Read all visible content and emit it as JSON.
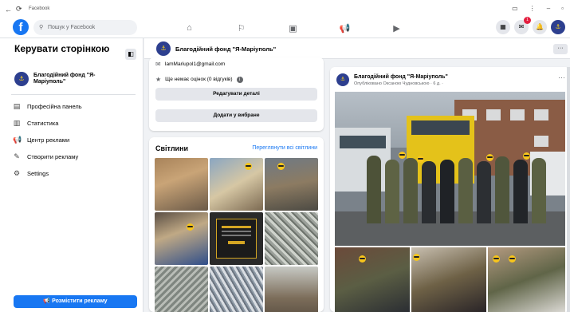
{
  "browser": {
    "title": "Facebook",
    "back": "←",
    "reload": "⟳"
  },
  "topbar": {
    "search_placeholder": "Пошук у Facebook",
    "notification_count": "1"
  },
  "sidebar": {
    "title": "Керувати сторінкою",
    "page_name": "Благодійний фонд \"Я-Маріуполь\"",
    "items": [
      {
        "label": "Професійна панель",
        "icon": "dashboard-icon"
      },
      {
        "label": "Статистика",
        "icon": "stats-icon"
      },
      {
        "label": "Центр реклами",
        "icon": "megaphone-icon"
      },
      {
        "label": "Створити рекламу",
        "icon": "edit-icon"
      },
      {
        "label": "Settings",
        "icon": "gear-icon"
      }
    ],
    "cta": "Розмістити рекламу"
  },
  "page_header": {
    "name": "Благодійний фонд \"Я-Маріуполь\"",
    "more": "···"
  },
  "info": {
    "email": "IamMariupol1@gmail.com",
    "rating": "Ще немає оцінок (0 відгуків)",
    "edit_button": "Редагувати деталі",
    "fav_button": "Додати у вибране"
  },
  "photos": {
    "title": "Світлини",
    "see_all": "Переглянути всі світлини"
  },
  "post": {
    "author": "Благодійний фонд \"Я-Маріуполь\"",
    "meta": "Опубліковано Оксаною Чудновською · 6 д. ·",
    "more": "···"
  },
  "colors": {
    "fb_blue": "#1877f2",
    "page_avatar_bg": "#2d3f8f",
    "avatar_yellow": "#f7d21c"
  }
}
